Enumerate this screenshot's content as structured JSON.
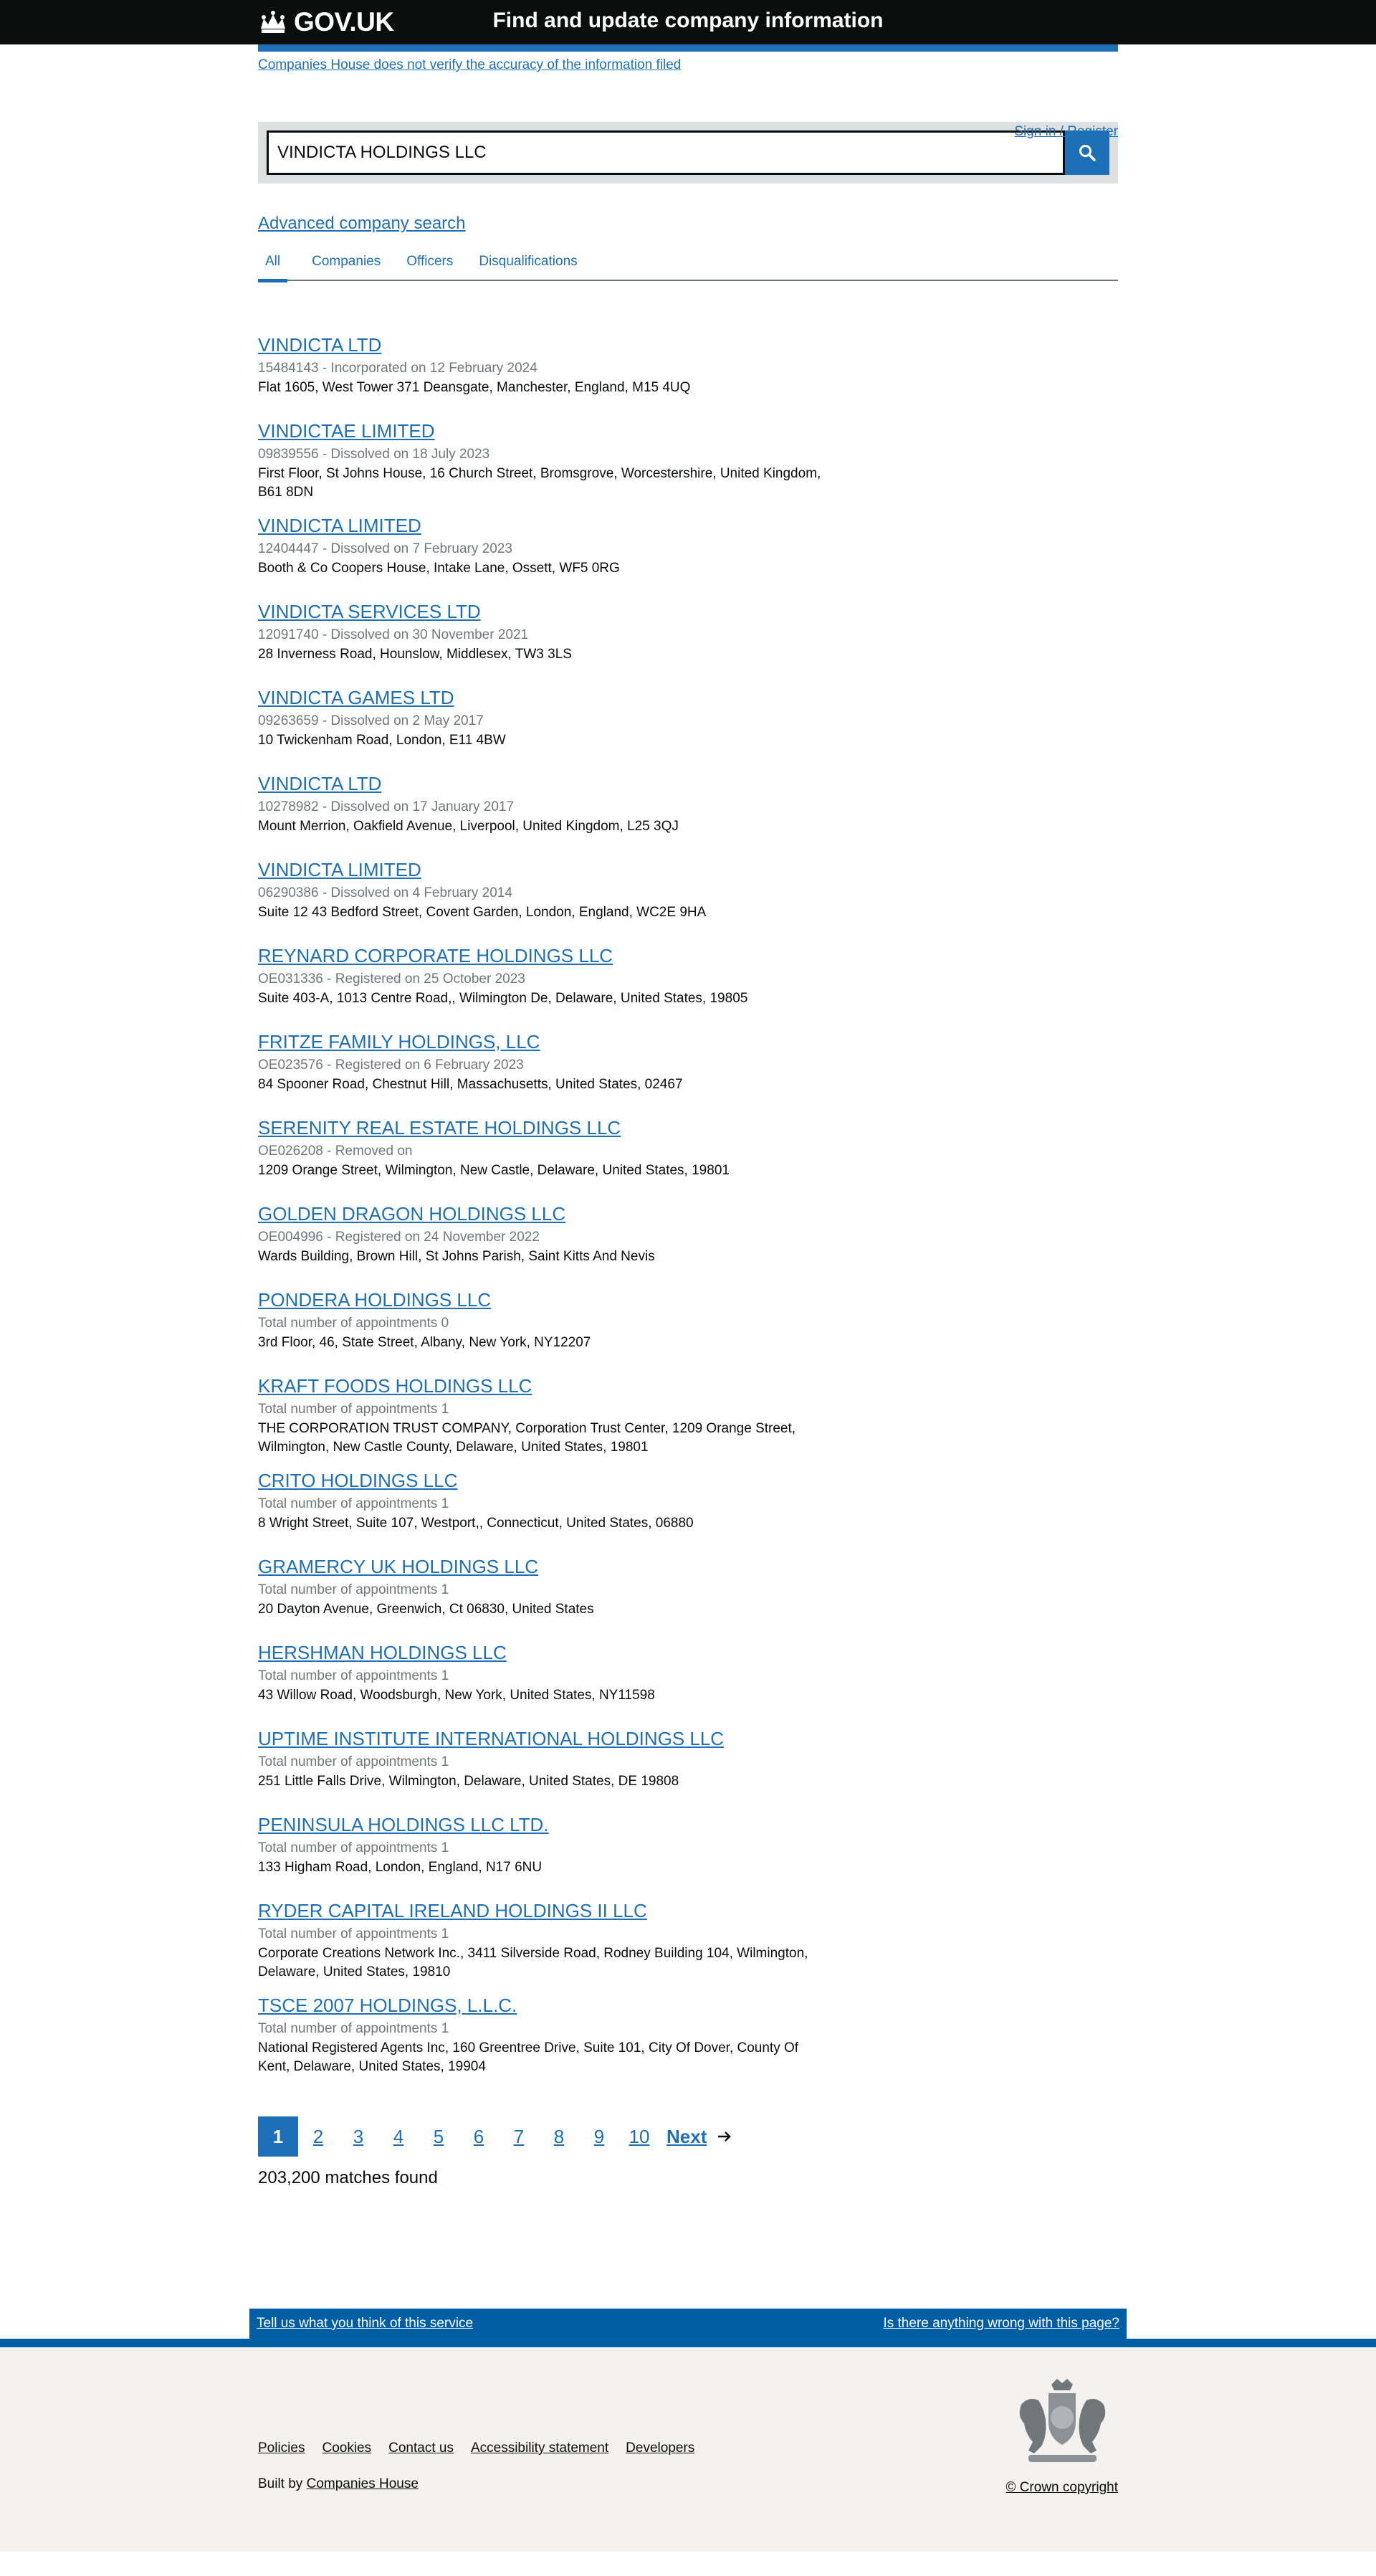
{
  "header": {
    "logo_text": "GOV.UK",
    "service_name": "Find and update company information"
  },
  "disclaimer": "Companies House does not verify the accuracy of the information filed",
  "signin": "Sign in / Register",
  "search": {
    "value": "VINDICTA HOLDINGS LLC",
    "button_icon": "search-icon"
  },
  "advanced_search": "Advanced company search",
  "tabs": [
    {
      "label": "All",
      "active": true
    },
    {
      "label": "Companies"
    },
    {
      "label": "Officers"
    },
    {
      "label": "Disqualifications"
    }
  ],
  "results": [
    {
      "title": "VINDICTA LTD",
      "meta": "15484143 - Incorporated on 12 February 2024",
      "address": "Flat 1605, West Tower 371 Deansgate, Manchester, England, M15 4UQ"
    },
    {
      "title": "VINDICTAE LIMITED",
      "meta": "09839556 - Dissolved on 18 July 2023",
      "address": "First Floor, St Johns House, 16 Church Street, Bromsgrove, Worcestershire, United Kingdom, B61 8DN"
    },
    {
      "title": "VINDICTA LIMITED",
      "meta": "12404447 - Dissolved on 7 February 2023",
      "address": "Booth & Co Coopers House, Intake Lane, Ossett, WF5 0RG"
    },
    {
      "title": "VINDICTA SERVICES LTD",
      "meta": "12091740 - Dissolved on 30 November 2021",
      "address": "28 Inverness Road, Hounslow, Middlesex, TW3 3LS"
    },
    {
      "title": "VINDICTA GAMES LTD",
      "meta": "09263659 - Dissolved on 2 May 2017",
      "address": "10 Twickenham Road, London, E11 4BW"
    },
    {
      "title": "VINDICTA LTD",
      "meta": "10278982 - Dissolved on 17 January 2017",
      "address": "Mount Merrion, Oakfield Avenue, Liverpool, United Kingdom, L25 3QJ"
    },
    {
      "title": "VINDICTA LIMITED",
      "meta": "06290386 - Dissolved on 4 February 2014",
      "address": "Suite 12 43 Bedford Street, Covent Garden, London, England, WC2E 9HA"
    },
    {
      "title": "REYNARD CORPORATE HOLDINGS LLC",
      "meta": "OE031336 - Registered on 25 October 2023",
      "address": "Suite 403-A, 1013 Centre Road,, Wilmington De, Delaware, United States, 19805"
    },
    {
      "title": "FRITZE FAMILY HOLDINGS, LLC",
      "meta": "OE023576 - Registered on 6 February 2023",
      "address": "84 Spooner Road, Chestnut Hill, Massachusetts, United States, 02467"
    },
    {
      "title": "SERENITY REAL ESTATE HOLDINGS LLC",
      "meta": "OE026208 - Removed on",
      "address": "1209 Orange Street, Wilmington, New Castle, Delaware, United States, 19801"
    },
    {
      "title": "GOLDEN DRAGON HOLDINGS LLC",
      "meta": "OE004996 - Registered on 24 November 2022",
      "address": "Wards Building, Brown Hill, St Johns Parish, Saint Kitts And Nevis"
    },
    {
      "title": "PONDERA HOLDINGS LLC",
      "meta": "Total number of appointments 0",
      "address": "3rd Floor, 46, State Street, Albany, New York, NY12207"
    },
    {
      "title": "KRAFT FOODS HOLDINGS LLC",
      "meta": "Total number of appointments 1",
      "address": "THE CORPORATION TRUST COMPANY, Corporation Trust Center, 1209 Orange Street, Wilmington, New Castle County, Delaware, United States, 19801"
    },
    {
      "title": "CRITO HOLDINGS LLC",
      "meta": "Total number of appointments 1",
      "address": "8 Wright Street, Suite 107, Westport,, Connecticut, United States, 06880"
    },
    {
      "title": "GRAMERCY UK HOLDINGS LLC",
      "meta": "Total number of appointments 1",
      "address": "20 Dayton Avenue, Greenwich, Ct 06830, United States"
    },
    {
      "title": "HERSHMAN HOLDINGS LLC",
      "meta": "Total number of appointments 1",
      "address": "43 Willow Road, Woodsburgh, New York, United States, NY11598"
    },
    {
      "title": "UPTIME INSTITUTE INTERNATIONAL HOLDINGS LLC",
      "meta": "Total number of appointments 1",
      "address": "251 Little Falls Drive, Wilmington, Delaware, United States, DE 19808"
    },
    {
      "title": "PENINSULA HOLDINGS LLC LTD.",
      "meta": "Total number of appointments 1",
      "address": "133 Higham Road, London, England, N17 6NU"
    },
    {
      "title": "RYDER CAPITAL IRELAND HOLDINGS II LLC",
      "meta": "Total number of appointments 1",
      "address": "Corporate Creations Network Inc., 3411 Silverside Road, Rodney Building 104, Wilmington, Delaware, United States, 19810"
    },
    {
      "title": "TSCE 2007 HOLDINGS, L.L.C.",
      "meta": "Total number of appointments 1",
      "address": "National Registered Agents Inc, 160 Greentree Drive, Suite 101, City Of Dover, County Of Kent, Delaware, United States, 19904"
    }
  ],
  "pagination": {
    "pages": [
      "1",
      "2",
      "3",
      "4",
      "5",
      "6",
      "7",
      "8",
      "9",
      "10"
    ],
    "current": "1",
    "next_label": "Next"
  },
  "matches": "203,200 matches found",
  "feedback": {
    "left": "Tell us what you think of this service",
    "right": "Is there anything wrong with this page?"
  },
  "footer": {
    "links": [
      "Policies",
      "Cookies",
      "Contact us",
      "Accessibility statement",
      "Developers"
    ],
    "built_by_prefix": "Built by",
    "built_by_link": "Companies House",
    "copyright": "© Crown copyright"
  }
}
